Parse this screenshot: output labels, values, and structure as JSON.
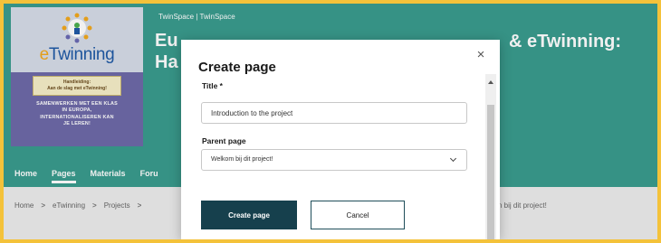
{
  "header": {
    "breadcrumb": "TwinSpace | TwinSpace",
    "title_left": "Eu\nHa",
    "title_right": "& eTwinning:"
  },
  "logo": {
    "word_e": "e",
    "word_rest": "Twinning",
    "tagline": "Handleiding:\nAan de slag met eTwinning!",
    "body": "SAMENWERKEN MET EEN KLAS\nIN EUROPA,\nINTERNATIONALISEREN KAN\nJE LEREN!"
  },
  "nav": {
    "items": [
      {
        "label": "Home",
        "active": false
      },
      {
        "label": "Pages",
        "active": true
      },
      {
        "label": "Materials",
        "active": false
      },
      {
        "label": "Foru",
        "active": false
      }
    ]
  },
  "breadcrumbs": {
    "items": [
      "Home",
      "eTwinning",
      "Projects"
    ],
    "separator": ">",
    "trailing": "n bij dit project!"
  },
  "modal": {
    "title": "Create page",
    "close_symbol": "×",
    "title_label": "Title *",
    "title_value": "Introduction to the project",
    "parent_label": "Parent page",
    "parent_value": "Welkom bij dit project!",
    "create_button": "Create page",
    "cancel_button": "Cancel"
  },
  "colors": {
    "header": "#3a9c8e",
    "primary_button": "#16404d",
    "frame_border": "#f4c23a"
  }
}
